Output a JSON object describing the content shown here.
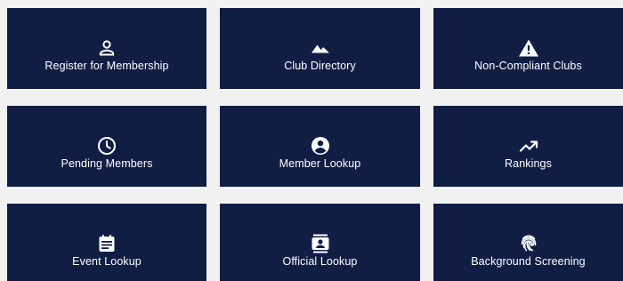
{
  "tiles": [
    {
      "label": "Register for Membership",
      "icon": "person-outline-icon"
    },
    {
      "label": "Club Directory",
      "icon": "mountains-icon"
    },
    {
      "label": "Non-Compliant Clubs",
      "icon": "warning-triangle-icon"
    },
    {
      "label": "Pending Members",
      "icon": "clock-icon"
    },
    {
      "label": "Member Lookup",
      "icon": "account-circle-icon"
    },
    {
      "label": "Rankings",
      "icon": "trending-up-icon"
    },
    {
      "label": "Event Lookup",
      "icon": "calendar-event-icon"
    },
    {
      "label": "Official Lookup",
      "icon": "contact-card-icon"
    },
    {
      "label": "Background Screening",
      "icon": "fingerprint-icon"
    }
  ],
  "colors": {
    "tile_background": "#101e44",
    "page_background": "#f1f1f1",
    "text": "#ffffff"
  }
}
